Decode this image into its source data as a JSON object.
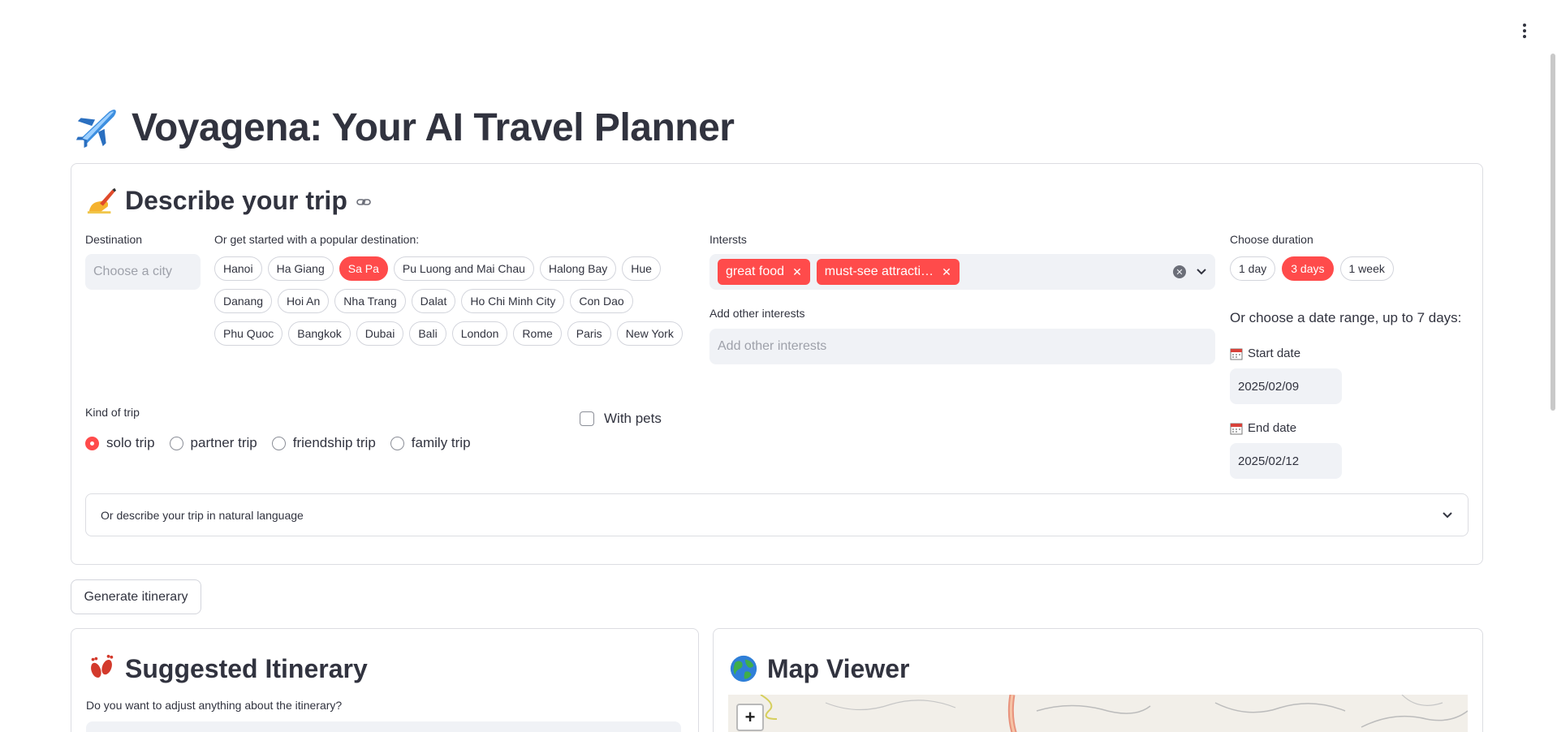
{
  "app": {
    "title": "Voyagena: Your AI Travel Planner",
    "title_icon": "airplane-icon"
  },
  "describe": {
    "heading": "Describe your trip",
    "heading_icon": "writing-hand-icon",
    "destination_label": "Destination",
    "destination_placeholder": "Choose a city",
    "popular_label": "Or get started with a popular destination:",
    "popular": [
      {
        "label": "Hanoi",
        "active": false
      },
      {
        "label": "Ha Giang",
        "active": false
      },
      {
        "label": "Sa Pa",
        "active": true
      },
      {
        "label": "Pu Luong and Mai Chau",
        "active": false
      },
      {
        "label": "Halong Bay",
        "active": false
      },
      {
        "label": "Hue",
        "active": false
      },
      {
        "label": "Danang",
        "active": false
      },
      {
        "label": "Hoi An",
        "active": false
      },
      {
        "label": "Nha Trang",
        "active": false
      },
      {
        "label": "Dalat",
        "active": false
      },
      {
        "label": "Ho Chi Minh City",
        "active": false
      },
      {
        "label": "Con Dao",
        "active": false
      },
      {
        "label": "Phu Quoc",
        "active": false
      },
      {
        "label": "Bangkok",
        "active": false
      },
      {
        "label": "Dubai",
        "active": false
      },
      {
        "label": "Bali",
        "active": false
      },
      {
        "label": "London",
        "active": false
      },
      {
        "label": "Rome",
        "active": false
      },
      {
        "label": "Paris",
        "active": false
      },
      {
        "label": "New York",
        "active": false
      }
    ],
    "interests_label": "Intersts",
    "interests": [
      "great food",
      "must-see attracti…"
    ],
    "other_interests_label": "Add other interests",
    "other_interests_placeholder": "Add other interests",
    "duration_label": "Choose duration",
    "durations": [
      {
        "label": "1 day",
        "active": false
      },
      {
        "label": "3 days",
        "active": true
      },
      {
        "label": "1 week",
        "active": false
      }
    ],
    "date_range_label": "Or choose a date range, up to 7 days:",
    "start_date_label": "Start date",
    "start_date": "2025/02/09",
    "end_date_label": "End date",
    "end_date": "2025/02/12",
    "kind_label": "Kind of trip",
    "kinds": [
      {
        "label": "solo trip",
        "checked": true
      },
      {
        "label": "partner trip",
        "checked": false
      },
      {
        "label": "friendship trip",
        "checked": false
      },
      {
        "label": "family trip",
        "checked": false
      }
    ],
    "pets_label": "With pets",
    "natural_language_label": "Or describe your trip in natural language"
  },
  "generate_button": "Generate itinerary",
  "itinerary": {
    "heading": "Suggested Itinerary",
    "heading_icon": "footprints-icon",
    "adjust_label": "Do you want to adjust anything about the itinerary?"
  },
  "map": {
    "heading": "Map Viewer",
    "heading_icon": "globe-icon",
    "zoom_in": "+"
  },
  "colors": {
    "accent": "#ff4b4b",
    "text": "#31333f",
    "input_bg": "#f0f2f6"
  }
}
